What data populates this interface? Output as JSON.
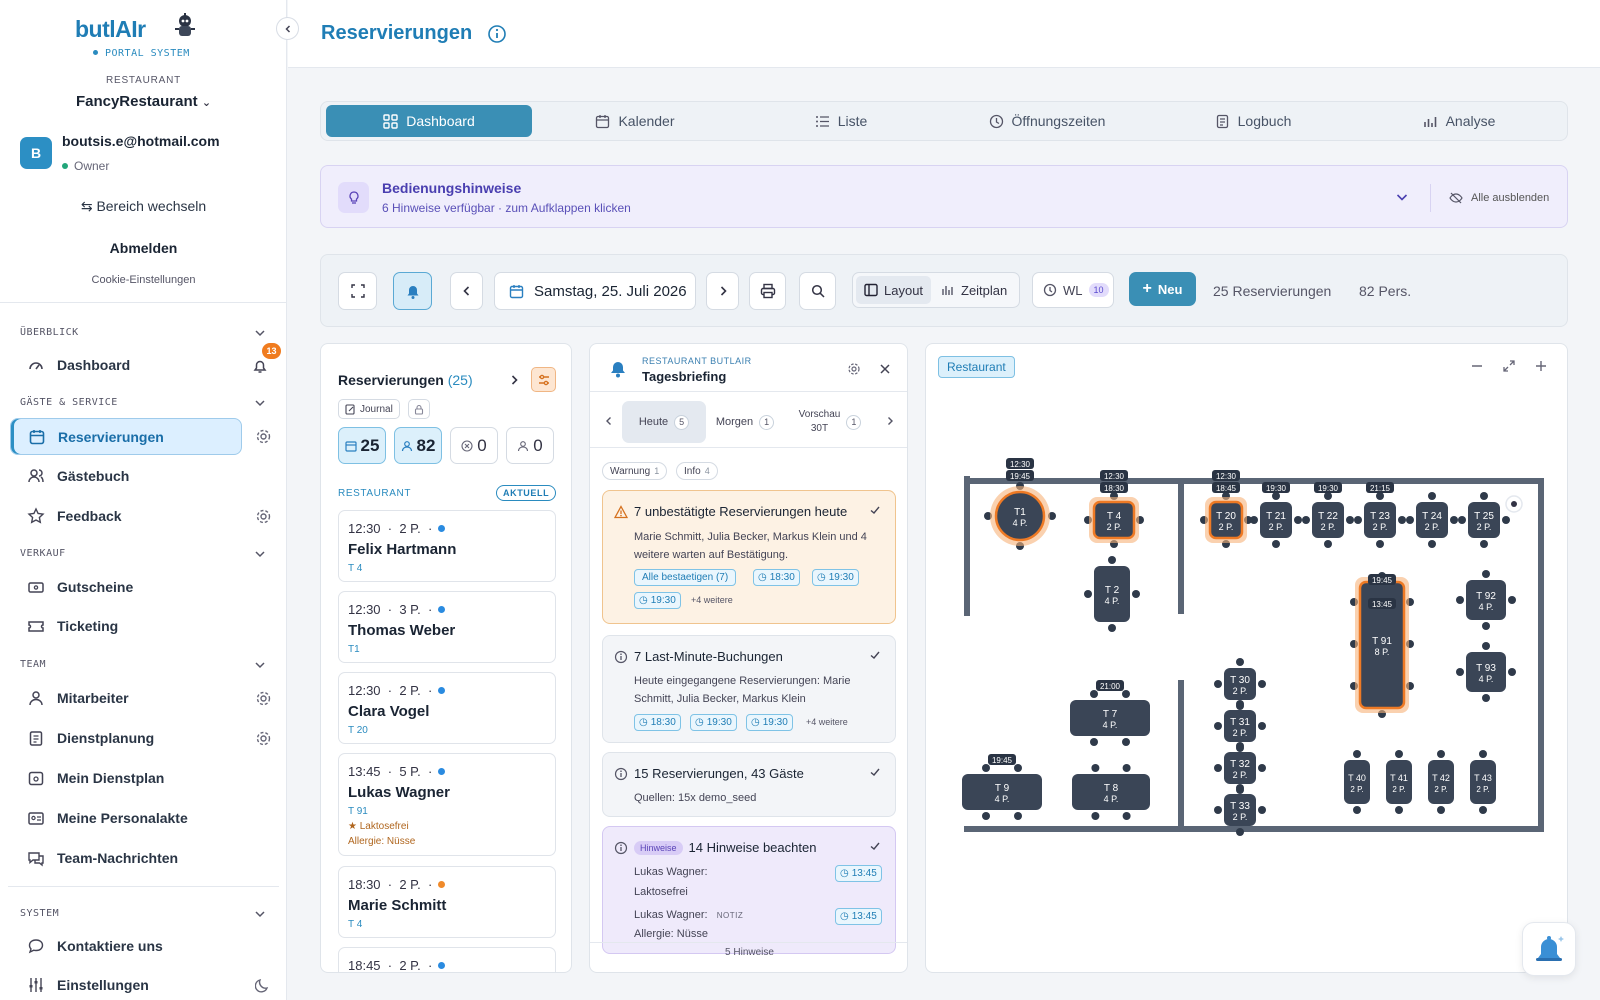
{
  "brand": {
    "name": "butlAIr",
    "subtitle": "PORTAL SYSTEM"
  },
  "restaurant": {
    "label": "RESTAURANT",
    "name": "FancyRestaurant"
  },
  "user": {
    "initial": "B",
    "email": "boutsis.e@hotmail.com",
    "role": "Owner"
  },
  "account": {
    "switch": "Bereich wechseln",
    "logout": "Abmelden",
    "cookie": "Cookie-Einstellungen"
  },
  "sidebar": {
    "sections": [
      "ÜBERBLICK",
      "GÄSTE & SERVICE",
      "VERKAUF",
      "TEAM",
      "SYSTEM"
    ],
    "items": [
      {
        "label": "Dashboard",
        "icon": "gauge-icon"
      },
      {
        "label": "Reservierungen",
        "icon": "calendar-icon"
      },
      {
        "label": "Gästebuch",
        "icon": "users-icon"
      },
      {
        "label": "Feedback",
        "icon": "star-icon"
      },
      {
        "label": "Gutscheine",
        "icon": "voucher-icon"
      },
      {
        "label": "Ticketing",
        "icon": "ticket-icon"
      },
      {
        "label": "Mitarbeiter",
        "icon": "user-icon"
      },
      {
        "label": "Dienstplanung",
        "icon": "clipboard-icon"
      },
      {
        "label": "Mein Dienstplan",
        "icon": "calendar-user-icon"
      },
      {
        "label": "Meine Personalakte",
        "icon": "id-card-icon"
      },
      {
        "label": "Team-Nachrichten",
        "icon": "chat-icon"
      },
      {
        "label": "Kontaktiere uns",
        "icon": "message-icon"
      },
      {
        "label": "Einstellungen",
        "icon": "sliders-icon"
      }
    ],
    "notification_count": "13"
  },
  "header": {
    "title": "Reservierungen"
  },
  "tabs": [
    "Dashboard",
    "Kalender",
    "Liste",
    "Öffnungszeiten",
    "Logbuch",
    "Analyse"
  ],
  "hints": {
    "title": "Bedienungshinweise",
    "subtitle": "6 Hinweise verfügbar · zum Aufklappen klicken",
    "hide_all": "Alle ausblenden"
  },
  "toolbar": {
    "date": "Samstag, 25. Juli 2026",
    "layout": "Layout",
    "zeitplan": "Zeitplan",
    "wl": "WL",
    "wl_count": "10",
    "new": "Neu",
    "reservations": "25 Reservierungen",
    "persons": "82 Pers."
  },
  "res_panel": {
    "title": "Reservierungen",
    "count": "(25)",
    "journal": "Journal",
    "stats": [
      "25",
      "82",
      "0",
      "0"
    ],
    "section": "RESTAURANT",
    "badge": "AKTUELL",
    "cards": [
      {
        "time": "12:30",
        "persons": "2 P.",
        "name": "Felix Hartmann",
        "table": "T 4",
        "dot": "#2a8be0"
      },
      {
        "time": "12:30",
        "persons": "3 P.",
        "name": "Thomas Weber",
        "table": "T1",
        "dot": "#2a8be0"
      },
      {
        "time": "12:30",
        "persons": "2 P.",
        "name": "Clara Vogel",
        "table": "T 20",
        "dot": "#2a8be0"
      },
      {
        "time": "13:45",
        "persons": "5 P.",
        "name": "Lukas Wagner",
        "table": "T 91",
        "dot": "#2a8be0",
        "note1": "Laktosefrei",
        "note2": "Allergie: Nüsse"
      },
      {
        "time": "18:30",
        "persons": "2 P.",
        "name": "Marie Schmitt",
        "table": "T 4",
        "dot": "#f08a2a"
      },
      {
        "time": "18:45",
        "persons": "2 P.",
        "name": "",
        "table": "",
        "dot": "#2a8be0"
      }
    ]
  },
  "briefing": {
    "kicker": "RESTAURANT BUTLAIR",
    "title": "Tagesbriefing",
    "tabs": [
      {
        "label": "Heute",
        "count": "5"
      },
      {
        "label": "Morgen",
        "count": "1"
      },
      {
        "label": "Vorschau",
        "sub": "30T",
        "count": "1"
      }
    ],
    "filters": [
      {
        "label": "Warnung",
        "count": "1"
      },
      {
        "label": "Info",
        "count": "4"
      }
    ],
    "card1": {
      "title": "7 unbestätigte Reservierungen heute",
      "text": "Marie Schmitt, Julia Becker, Markus Klein und 4 weitere warten auf Bestätigung.",
      "action": "Alle bestaetigen (7)",
      "times": [
        "18:30",
        "19:30",
        "19:30"
      ],
      "more": "+4 weitere"
    },
    "card2": {
      "title": "7 Last-Minute-Buchungen",
      "text": "Heute eingegangene Reservierungen: Marie Schmitt, Julia Becker, Markus Klein",
      "times": [
        "18:30",
        "19:30",
        "19:30"
      ],
      "more": "+4 weitere"
    },
    "card3": {
      "title": "15 Reservierungen, 43 Gäste",
      "text": "Quellen: 15x demo_seed"
    },
    "card4": {
      "pill": "Hinweise",
      "title": "14 Hinweise beachten",
      "l1": "Lukas Wagner:",
      "l1b": "Laktosefrei",
      "l2": "Lukas Wagner:",
      "notiz": "NOTIZ",
      "l2b": "Allergie: Nüsse",
      "time": "13:45"
    },
    "footer": "5 Hinweise"
  },
  "floor": {
    "area": "Restaurant",
    "tables": [
      {
        "id": "T1",
        "seats": "4 P.",
        "times": [
          "12:30",
          "19:45"
        ],
        "highlight": true
      },
      {
        "id": "T 4",
        "seats": "2 P.",
        "times": [
          "12:30",
          "18:30"
        ],
        "highlight": true
      },
      {
        "id": "T 2",
        "seats": "4 P.",
        "times": []
      },
      {
        "id": "T 20",
        "seats": "2 P.",
        "times": [
          "12:30",
          "18:45"
        ],
        "highlight": true
      },
      {
        "id": "T 21",
        "seats": "2 P.",
        "times": [
          "19:30"
        ]
      },
      {
        "id": "T 22",
        "seats": "2 P.",
        "times": [
          "19:30"
        ]
      },
      {
        "id": "T 23",
        "seats": "2 P.",
        "times": [
          "21:15"
        ]
      },
      {
        "id": "T 24",
        "seats": "2 P.",
        "times": []
      },
      {
        "id": "T 25",
        "seats": "2 P.",
        "times": []
      },
      {
        "id": "T 91",
        "seats": "8 P.",
        "times": [
          "13:45",
          "19:45"
        ],
        "highlight": true
      },
      {
        "id": "T 92",
        "seats": "4 P.",
        "times": []
      },
      {
        "id": "T 93",
        "seats": "4 P.",
        "times": []
      },
      {
        "id": "T 7",
        "seats": "4 P.",
        "times": [
          "21:00"
        ]
      },
      {
        "id": "T 30",
        "seats": "2 P.",
        "times": []
      },
      {
        "id": "T 31",
        "seats": "2 P.",
        "times": []
      },
      {
        "id": "T 32",
        "seats": "2 P.",
        "times": []
      },
      {
        "id": "T 33",
        "seats": "2 P.",
        "times": []
      },
      {
        "id": "T 9",
        "seats": "4 P.",
        "times": [
          "19:45"
        ]
      },
      {
        "id": "T 8",
        "seats": "4 P.",
        "times": []
      },
      {
        "id": "T 40",
        "seats": "2 P.",
        "times": []
      },
      {
        "id": "T 41",
        "seats": "2 P.",
        "times": []
      },
      {
        "id": "T 42",
        "seats": "2 P.",
        "times": []
      },
      {
        "id": "T 43",
        "seats": "2 P.",
        "times": []
      }
    ]
  }
}
